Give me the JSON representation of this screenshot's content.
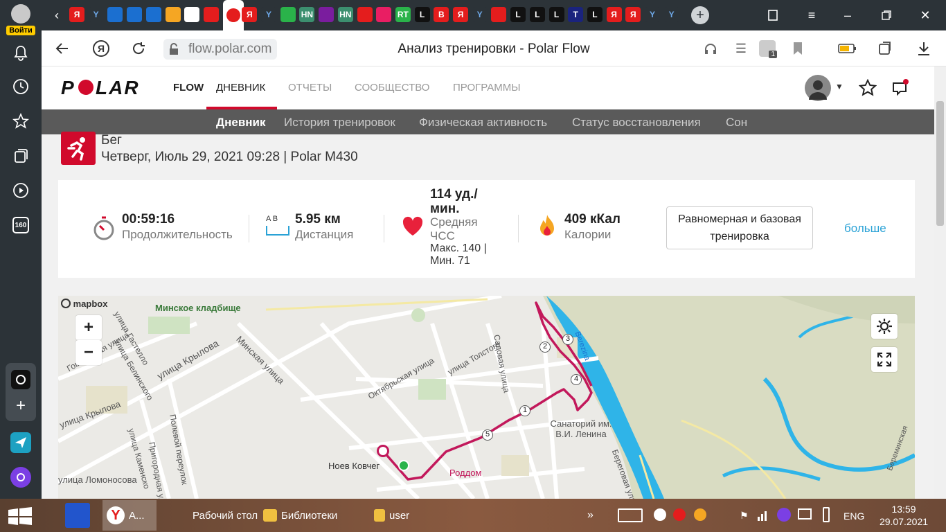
{
  "sidebar": {
    "login_label": "Войти",
    "badge_160": "160"
  },
  "tabs": {
    "items": [
      "Я",
      "Y",
      "",
      "",
      "",
      "",
      "",
      "",
      "",
      "Я",
      "Y",
      "",
      "HN",
      "",
      "HN",
      "",
      "",
      "RT",
      "L",
      "B",
      "Я",
      "Y",
      "",
      "L",
      "L",
      "L",
      "T",
      "L",
      "Я",
      "Я",
      "Y",
      "Y"
    ],
    "new_tab": "+"
  },
  "toolbar": {
    "url": "flow.polar.com",
    "page_title": "Анализ тренировки - Polar Flow"
  },
  "nav": {
    "brand": "POLAR",
    "flow": "FLOW",
    "items": [
      "ДНЕВНИК",
      "ОТЧЕТЫ",
      "СООБЩЕСТВО",
      "ПРОГРАММЫ"
    ]
  },
  "subnav": {
    "items": [
      "Дневник",
      "История тренировок",
      "Физическая активность",
      "Статус восстановления",
      "Сон"
    ]
  },
  "workout": {
    "sport": "Бег",
    "datetime": "Четверг, Июль 29, 2021 09:28 | Polar M430"
  },
  "stats": {
    "duration_value": "00:59:16",
    "duration_label": "Продолжительность",
    "distance_ab": "A  B",
    "distance_value": "5.95 км",
    "distance_label": "Дистанция",
    "hr_value": "114 уд./ мин.",
    "hr_label": "Средняя ЧСС",
    "hr_range": "Макс. 140  |  Мин. 71",
    "calories_value": "409 кКал",
    "calories_label": "Калории",
    "zone_button": "Равномерная и базовая тренировка",
    "more": "больше"
  },
  "map": {
    "attribution": "mapbox",
    "zoom_in": "+",
    "zoom_out": "−",
    "labels": [
      "Минское кладбище",
      "улица Гастелло",
      "улица Белинского",
      "Гомельская улица",
      "улица Крылова",
      "Минская улица",
      "Октябрьская улица",
      "улица Толстого",
      "Садовая улица",
      "Полевой переулок",
      "улица Каменско",
      "Пригородная улица",
      "улица Крылова",
      "улица Ломоносова",
      "Ноев Ковчег",
      "Роддом",
      "Санаторий им. В.И. Ленина",
      "Berezina",
      "Береговая улица",
      "Береминская"
    ],
    "route_markers": [
      "1",
      "2",
      "3",
      "4",
      "5"
    ],
    "route_color": "#c2185b"
  },
  "taskbar": {
    "items": [
      "А...",
      "Рабочий стол",
      "Библиотеки",
      "user"
    ],
    "lang": "ENG",
    "time": "13:59",
    "date": "29.07.2021"
  }
}
